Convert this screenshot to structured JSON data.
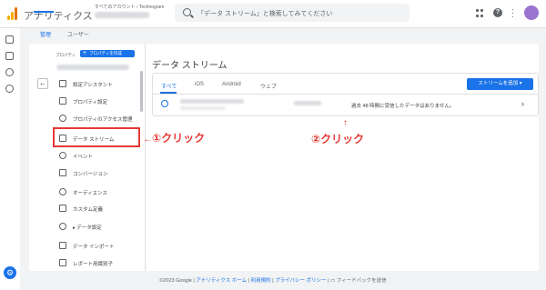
{
  "header": {
    "app_title": "アナリティクス",
    "breadcrumb": "すべてのアカウント › Technogram",
    "search_placeholder": "「データ ストリーム」と検索してみてください"
  },
  "admin_tabs": [
    {
      "label": "管理",
      "active": true
    },
    {
      "label": "ユーザー",
      "active": false
    }
  ],
  "property": {
    "label": "プロパティ",
    "create_button": "プロパティを作成"
  },
  "menu": [
    {
      "label": "設定アシスタント",
      "icon": "checklist-icon"
    },
    {
      "label": "プロパティ設定",
      "icon": "property-settings-icon"
    },
    {
      "label": "プロパティのアクセス管理",
      "icon": "people-icon"
    },
    {
      "label": "データ ストリーム",
      "icon": "data-stream-icon",
      "highlighted": true
    },
    {
      "label": "イベント",
      "icon": "touch-icon"
    },
    {
      "label": "コンバージョン",
      "icon": "flag-icon"
    },
    {
      "label": "オーディエンス",
      "icon": "audience-icon"
    },
    {
      "label": "カスタム定義",
      "icon": "custom-definition-icon"
    },
    {
      "label": "▸ データ設定",
      "icon": "database-icon"
    },
    {
      "label": "データ インポート",
      "icon": "upload-icon"
    },
    {
      "label": "レポート用識別子",
      "icon": "identity-icon"
    }
  ],
  "annotations": {
    "step1": "①クリック",
    "step2": "②クリック"
  },
  "streams": {
    "title": "データ ストリーム",
    "tabs": [
      {
        "label": "すべて",
        "active": true
      },
      {
        "label": "iOS",
        "active": false
      },
      {
        "label": "Android",
        "active": false
      },
      {
        "label": "ウェブ",
        "active": false
      }
    ],
    "add_button": "ストリームを追加",
    "row_status": "過去 48 時間に受信したデータはありません。"
  },
  "footer": {
    "copyright": "©2023 Google",
    "home": "アナリティクス ホーム",
    "terms": "利用規約",
    "privacy": "プライバシー ポリシー",
    "feedback": "フィードバックを送信"
  },
  "colors": {
    "accent": "#1a73e8",
    "annotation": "#e53935"
  }
}
